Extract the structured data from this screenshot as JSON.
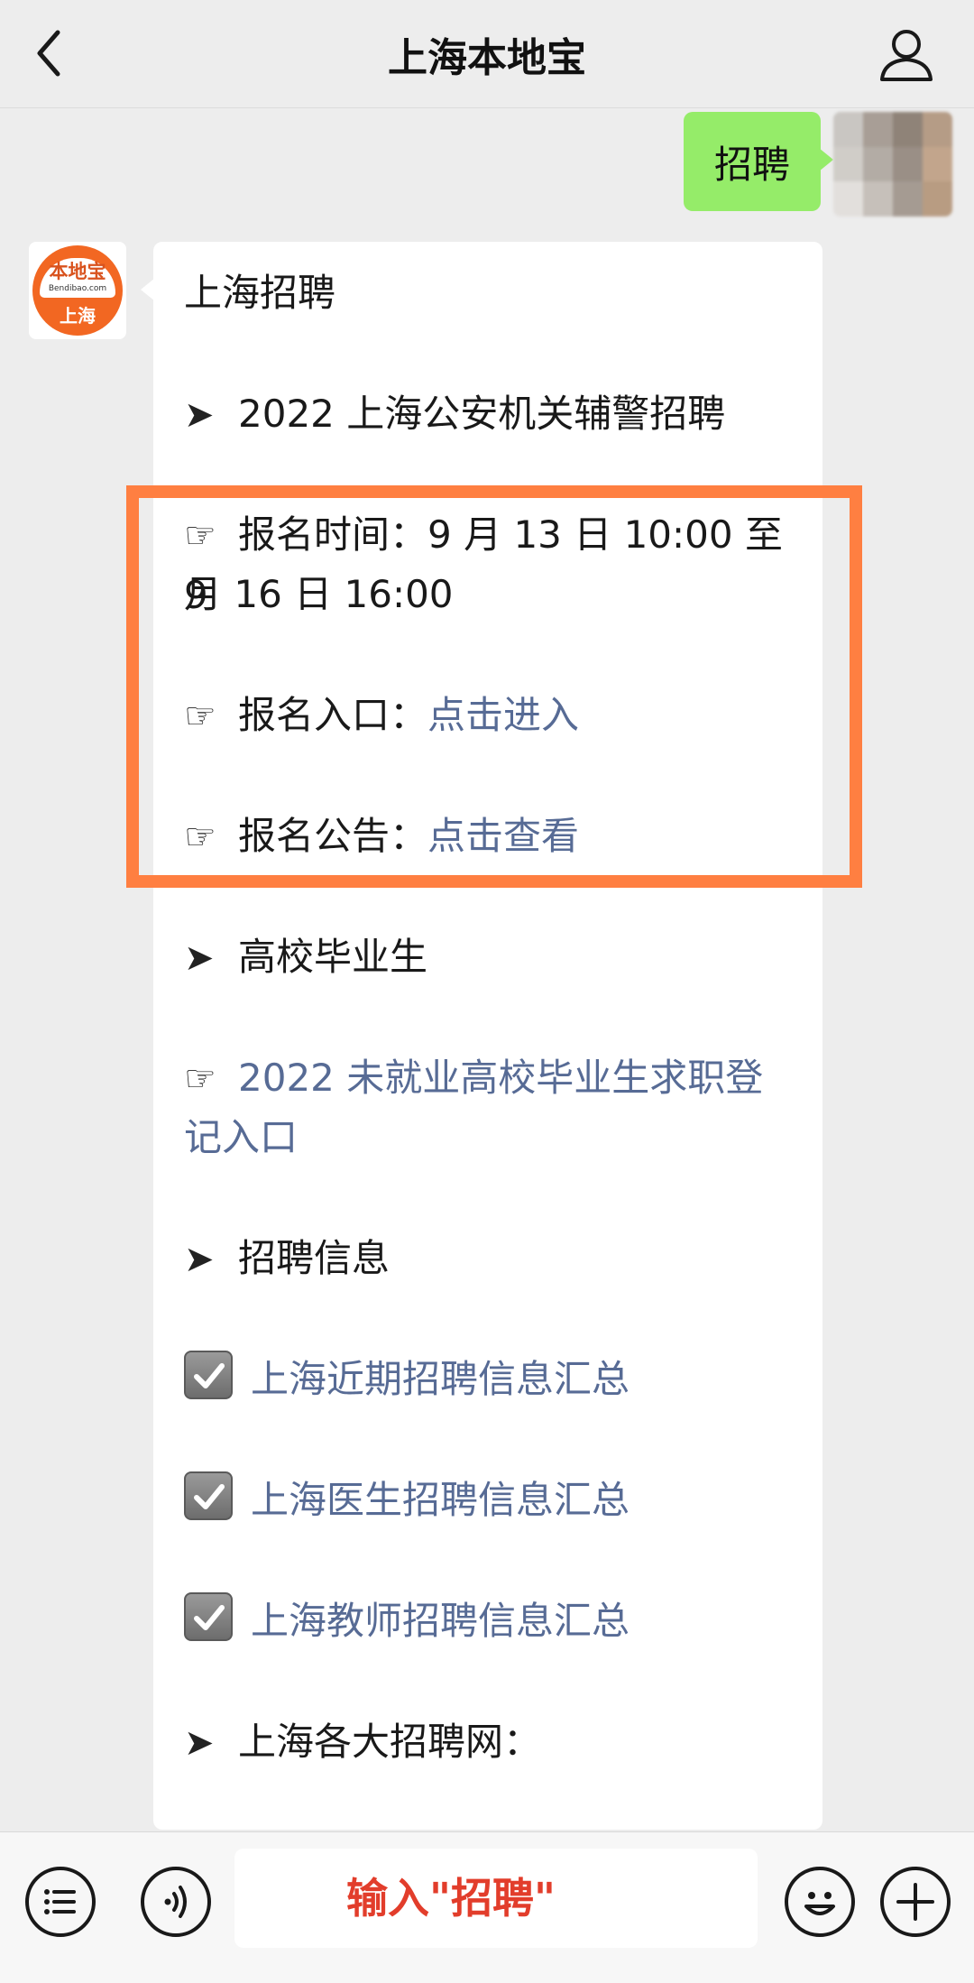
{
  "header": {
    "title": "上海本地宝"
  },
  "outgoing": {
    "text": "招聘"
  },
  "bot_avatar": {
    "logo_name": "本地宝",
    "logo_domain": "Bendibao.com",
    "logo_city": "上海"
  },
  "reply": {
    "heading": "上海招聘",
    "section1_title": "2022 上海公安机关辅警招聘",
    "signup_time_label": "报名时间：",
    "signup_time_value": "9 月 13 日 10:00 至 9",
    "signup_time_value2": "月 16 日 16:00",
    "entry_label": "报名入口：",
    "entry_link": "点击进入",
    "notice_label": "报名公告：",
    "notice_link": "点击查看",
    "section2_title": "高校毕业生",
    "grad_link_1": "2022 未就业高校毕业生求职登",
    "grad_link_2": "记入口",
    "section3_title": "招聘信息",
    "info_items": [
      "上海近期招聘信息汇总",
      "上海医生招聘信息汇总",
      "上海教师招聘信息汇总"
    ],
    "section4_title": "上海各大招聘网："
  },
  "symbols": {
    "arrow": "➤",
    "pointer": "☞"
  },
  "input": {
    "text": "输入\"招聘\""
  },
  "colors": {
    "bubble_green": "#95ec69",
    "link": "#576b95",
    "highlight": "#ff7f41",
    "input_text": "#e23d2b"
  }
}
